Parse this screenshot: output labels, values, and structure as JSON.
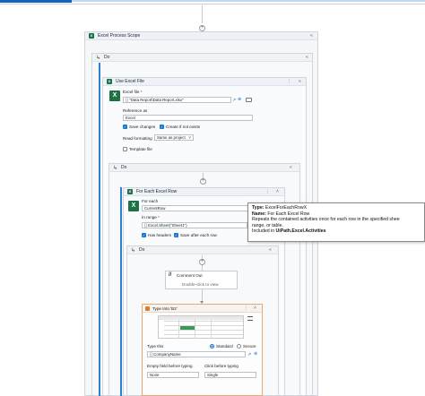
{
  "colors": {
    "accent": "#1976d2",
    "excel_green": "#1e7145",
    "panel_bg": "#f5f7f9"
  },
  "excel_process_scope": {
    "title": "Excel Process Scope"
  },
  "do_outer": {
    "title": "Do"
  },
  "use_excel_file": {
    "title": "Use Excel File",
    "excel_file_label": "Excel file",
    "excel_file_required": "*",
    "excel_file_value": "\"Data Report\\Data Report.xlsx\"",
    "reference_as_label": "Reference as",
    "reference_as_value": "Excel",
    "save_changes_label": "Save changes",
    "create_if_not_exists_label": "Create if not exists",
    "read_formatting_label": "Read formatting",
    "read_formatting_value": "Same as project",
    "template_file_label": "Template file"
  },
  "do_inner": {
    "title": "Do"
  },
  "for_each_excel_row": {
    "title": "For Each Excel Row",
    "for_each_label": "For each",
    "for_each_value": "CurrentRow",
    "in_range_label": "In range",
    "in_range_required": "*",
    "in_range_value": "Excel.Sheet(\"Sheet1\")",
    "has_headers_label": "Has headers",
    "save_after_each_row_label": "Save after each row"
  },
  "tooltip": {
    "type_label": "Type:",
    "type_value": "ExcelForEachRowX",
    "name_label": "Name:",
    "name_value": "For Each Excel Row",
    "description_line1": "Repeats the contained activities once for each row in the specified shee",
    "description_line2": "range, or table.",
    "included_prefix": "Included in ",
    "included_package": "UiPath.Excel.Activities"
  },
  "do_body": {
    "title": "Do"
  },
  "comment_out": {
    "title": "Comment Out",
    "hint": "Double-click to view"
  },
  "type_into": {
    "title": "Type Into 'B2'",
    "type_this_label": "Type this",
    "standard_label": "Standard",
    "secure_label": "Secure",
    "type_this_value": "CompanyName",
    "empty_field_label": "Empty field before typing",
    "click_before_label": "Click before typing",
    "empty_field_value": "None",
    "click_before_value": "Single"
  },
  "icons": {
    "add": "+",
    "collapse": "«",
    "more": "⋮",
    "expand_up": "˄",
    "do": "↳",
    "check": "✓",
    "comment": "//",
    "folder": "📁"
  }
}
